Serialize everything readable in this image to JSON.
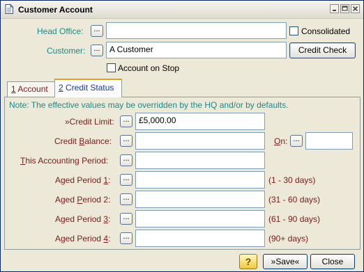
{
  "window": {
    "title": "Customer Account",
    "icon": "document-icon",
    "controls": [
      "minimize-icon",
      "maximize-icon",
      "close-icon"
    ]
  },
  "head_office": {
    "label": "Head Office:",
    "value": ""
  },
  "consolidated": {
    "label": "Consolidated",
    "checked": false
  },
  "customer": {
    "label": "Customer:",
    "value": "A Customer"
  },
  "credit_check_button": "Credit Check",
  "account_on_stop": {
    "label": "Account on Stop",
    "checked": false
  },
  "tabs": [
    {
      "num": "1",
      "label": " Account",
      "selected": false
    },
    {
      "num": "2",
      "label": " Credit Status",
      "selected": true
    }
  ],
  "note": "Note: The effective values may be overridden by the HQ and/or by defaults.",
  "dots_label": "...",
  "credit_limit": {
    "label": "»Credit Limit:",
    "value": "£5,000.00"
  },
  "credit_balance": {
    "label": "Credit Balance:",
    "value": ""
  },
  "on": {
    "label": "On:",
    "value": ""
  },
  "this_period": {
    "label": "This Accounting Period:",
    "value": ""
  },
  "aged": [
    {
      "label": "Aged Period 1:",
      "value": "",
      "range": "(1 - 30 days)"
    },
    {
      "label": "Aged Period 2:",
      "value": "",
      "range": "(31 - 60 days)"
    },
    {
      "label": "Aged Period 3:",
      "value": "",
      "range": "(61 - 90 days)"
    },
    {
      "label": "Aged Period 4:",
      "value": "",
      "range": "(90+ days)"
    }
  ],
  "help_icon_text": "?",
  "save_button": "»Save«",
  "close_button": "Close",
  "colors": {
    "teal_label": "#1d8a88",
    "maroon_label": "#7a1a1a",
    "tab_selected_text": "#1a3aa0"
  }
}
